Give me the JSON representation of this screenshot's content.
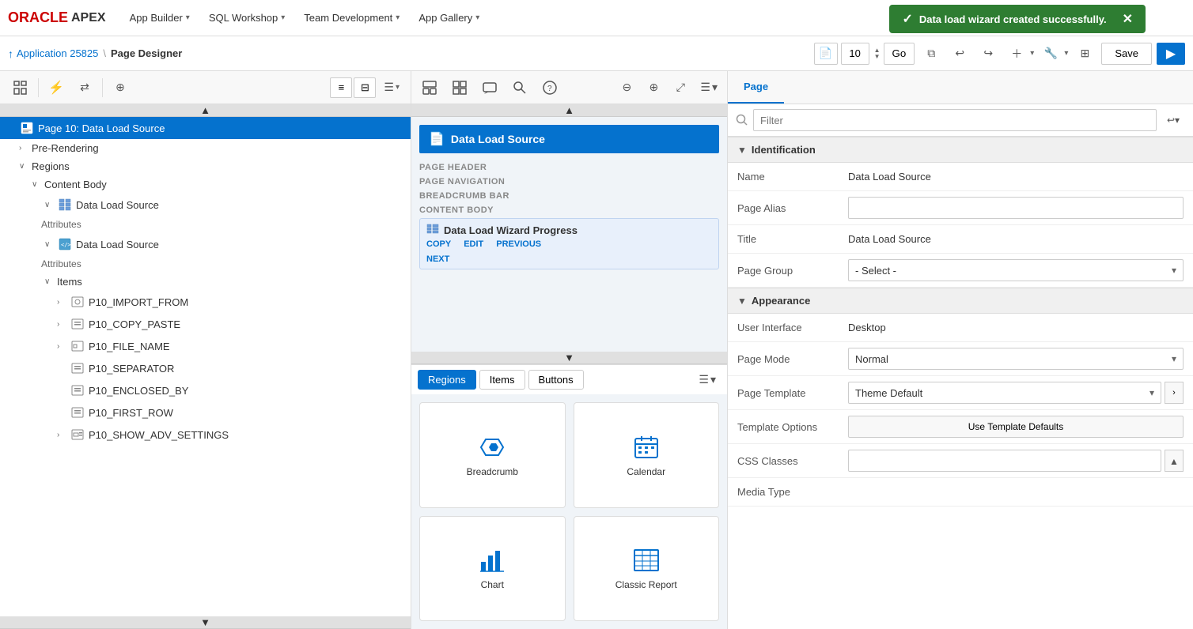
{
  "topnav": {
    "oracle_text": "ORACLE",
    "apex_text": "APEX",
    "items": [
      {
        "label": "App Builder",
        "id": "app-builder"
      },
      {
        "label": "SQL Workshop",
        "id": "sql-workshop"
      },
      {
        "label": "Team Development",
        "id": "team-dev"
      },
      {
        "label": "App Gallery",
        "id": "app-gallery"
      }
    ]
  },
  "success_banner": {
    "message": "Data load wizard created successfully.",
    "close": "✕"
  },
  "second_toolbar": {
    "app_link": "Application 25825",
    "separator": "\\",
    "page_designer": "Page Designer",
    "page_num": "10",
    "go_label": "Go",
    "save_label": "Save"
  },
  "left_panel": {
    "page_title": "Page 10: Data Load Source",
    "items": [
      {
        "id": "pre-rendering",
        "label": "Pre-Rendering",
        "indent": 1,
        "chevron": "›",
        "type": "plain"
      },
      {
        "id": "regions",
        "label": "Regions",
        "indent": 1,
        "chevron": "∨",
        "type": "plain"
      },
      {
        "id": "content-body",
        "label": "Content Body",
        "indent": 2,
        "chevron": "∨",
        "type": "plain"
      },
      {
        "id": "data-load-wizard",
        "label": "Data Load Wizard Progress",
        "indent": 3,
        "chevron": "∨",
        "type": "list"
      },
      {
        "id": "attributes-1",
        "label": "Attributes",
        "indent": 4,
        "type": "attr"
      },
      {
        "id": "data-load-source",
        "label": "Data Load Source",
        "indent": 3,
        "chevron": "∨",
        "type": "code"
      },
      {
        "id": "attributes-2",
        "label": "Attributes",
        "indent": 4,
        "type": "attr"
      },
      {
        "id": "items",
        "label": "Items",
        "indent": 3,
        "chevron": "∨",
        "type": "plain"
      },
      {
        "id": "p10-import-from",
        "label": "P10_IMPORT_FROM",
        "indent": 4,
        "chevron": "›",
        "type": "item"
      },
      {
        "id": "p10-copy-paste",
        "label": "P10_COPY_PASTE",
        "indent": 4,
        "chevron": "›",
        "type": "item2"
      },
      {
        "id": "p10-file-name",
        "label": "P10_FILE_NAME",
        "indent": 4,
        "chevron": "›",
        "type": "item3"
      },
      {
        "id": "p10-separator",
        "label": "P10_SEPARATOR",
        "indent": 4,
        "type": "item2"
      },
      {
        "id": "p10-enclosed-by",
        "label": "P10_ENCLOSED_BY",
        "indent": 4,
        "type": "item2"
      },
      {
        "id": "p10-first-row",
        "label": "P10_FIRST_ROW",
        "indent": 4,
        "type": "item4"
      },
      {
        "id": "p10-show-adv",
        "label": "P10_SHOW_ADV_SETTINGS",
        "indent": 4,
        "chevron": "›",
        "type": "item5"
      }
    ]
  },
  "middle_panel": {
    "page_title": "Data Load Source",
    "sections": [
      {
        "label": "PAGE HEADER"
      },
      {
        "label": "PAGE NAVIGATION"
      },
      {
        "label": "BREADCRUMB BAR"
      },
      {
        "label": "CONTENT BODY"
      }
    ],
    "region": {
      "title": "Data Load Wizard Progress",
      "actions": [
        "COPY",
        "EDIT",
        "PREVIOUS"
      ],
      "next": "NEXT"
    },
    "tabs": [
      {
        "label": "Regions",
        "active": true
      },
      {
        "label": "Items",
        "active": false
      },
      {
        "label": "Buttons",
        "active": false
      }
    ],
    "components": [
      {
        "label": "Breadcrumb",
        "icon": "breadcrumb"
      },
      {
        "label": "Calendar",
        "icon": "calendar"
      },
      {
        "label": "Chart",
        "icon": "chart"
      },
      {
        "label": "Classic Report",
        "icon": "classic-report"
      }
    ]
  },
  "right_panel": {
    "tabs": [
      {
        "label": "Page",
        "active": true
      }
    ],
    "filter_placeholder": "Filter",
    "sections": [
      {
        "title": "Identification",
        "expanded": true,
        "rows": [
          {
            "label": "Name",
            "value": "Data Load Source",
            "type": "text"
          },
          {
            "label": "Page Alias",
            "value": "",
            "type": "text"
          },
          {
            "label": "Title",
            "value": "Data Load Source",
            "type": "text"
          },
          {
            "label": "Page Group",
            "value": "- Select -",
            "type": "select"
          }
        ]
      },
      {
        "title": "Appearance",
        "expanded": true,
        "rows": [
          {
            "label": "User Interface",
            "value": "Desktop",
            "type": "text"
          },
          {
            "label": "Page Mode",
            "value": "Normal",
            "type": "select"
          },
          {
            "label": "Page Template",
            "value": "Theme Default",
            "type": "select-btn"
          },
          {
            "label": "Template Options",
            "value": "Use Template Defaults",
            "type": "btn"
          },
          {
            "label": "CSS Classes",
            "value": "",
            "type": "input-up"
          },
          {
            "label": "Media Type",
            "value": "",
            "type": "text"
          }
        ]
      }
    ]
  }
}
